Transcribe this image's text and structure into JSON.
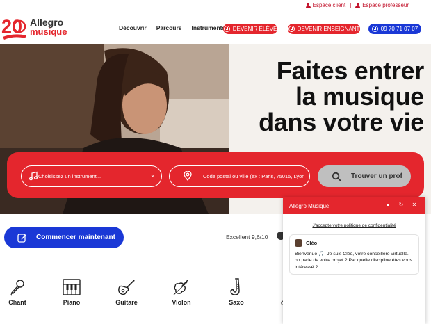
{
  "top_links": {
    "client": "Espace client",
    "separator": "|",
    "teacher": "Espace professeur"
  },
  "logo": {
    "number": "20",
    "line1": "Allegro",
    "line2": "musique"
  },
  "nav": {
    "items": [
      {
        "label": "Découvrir"
      },
      {
        "label": "Parcours"
      },
      {
        "label": "Instruments"
      }
    ]
  },
  "header_buttons": {
    "become_student": "DEVENIR ÉLÈVE",
    "become_teacher": "DEVENIR ENSEIGNANT",
    "phone": "09 70 71 07 07"
  },
  "hero": {
    "title_line1": "Faites entrer",
    "title_line2": "la musique",
    "title_line3": "dans votre vie"
  },
  "search": {
    "instrument_placeholder": "Choisissez un instrument...",
    "location_placeholder": "Code postal ou ville (ex : Paris, 75015, Lyon",
    "submit_label": "Trouver un prof"
  },
  "cta": {
    "label": "Commencer maintenant"
  },
  "rating": {
    "text": "Excellent 9,6/10"
  },
  "instruments": [
    {
      "label": "Chant",
      "icon": "microphone-icon"
    },
    {
      "label": "Piano",
      "icon": "piano-icon"
    },
    {
      "label": "Guitare",
      "icon": "guitar-icon"
    },
    {
      "label": "Violon",
      "icon": "violin-icon"
    },
    {
      "label": "Saxo",
      "icon": "saxophone-icon"
    }
  ],
  "instruments_cut_label": "C",
  "chat": {
    "title": "Allegro Musique",
    "policy": "J'accepte votre politique de confidentialité",
    "agent_name": "Cléo",
    "message": "Bienvenue 🎵! Je suis Cléo, votre conseillère virtuelle. on parle de votre projet ? Par quelle discipline êtes vous intéressé ?"
  },
  "colors": {
    "brand_red": "#e4262d",
    "brand_blue": "#1a38d6",
    "button_grey": "#bfbfbf"
  }
}
